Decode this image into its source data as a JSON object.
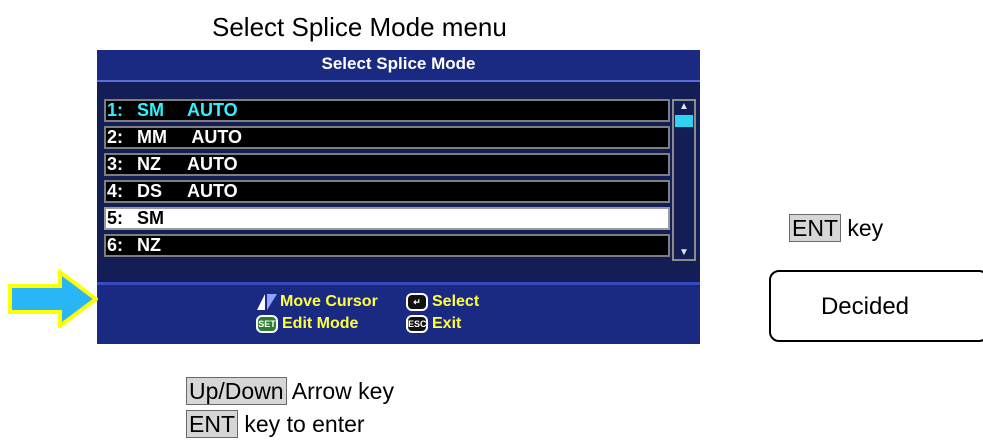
{
  "caption_top": "Select Splice Mode menu",
  "screen": {
    "title": "Select Splice Mode",
    "modes": [
      {
        "num": "1:",
        "fiber": "SM",
        "mode": "AUTO",
        "state": "highlight"
      },
      {
        "num": "2:",
        "fiber": "MM",
        "mode": " AUTO",
        "state": "normal"
      },
      {
        "num": "3:",
        "fiber": "NZ",
        "mode": "AUTO",
        "state": "normal"
      },
      {
        "num": "4:",
        "fiber": "DS",
        "mode": "AUTO",
        "state": "normal"
      },
      {
        "num": "5:",
        "fiber": "SM",
        "mode": "",
        "state": "selected"
      },
      {
        "num": "6:",
        "fiber": "NZ",
        "mode": "",
        "state": "normal"
      }
    ],
    "scrollbar": {
      "position_fraction": 0.0
    },
    "footer": {
      "move_cursor": "Move Cursor",
      "select": "Select",
      "edit_mode": "Edit Mode",
      "exit": "Exit",
      "set_badge": "SET",
      "esc_badge": "ESC"
    }
  },
  "annotations": {
    "ent_key_right": {
      "key": "ENT",
      "text": " key"
    },
    "decided": "Decided",
    "up_down": {
      "key": "Up/Down",
      "text": " Arrow key"
    },
    "ent_enter": {
      "key": "ENT",
      "text": " key to enter"
    }
  },
  "colors": {
    "screen_bg": "#141e56",
    "title_bar": "#1a2a82",
    "highlight_text": "#2ef2ff",
    "footer_text": "#ffff44",
    "pointer_arrow": "#29b6f6",
    "pointer_outline": "#ffff00"
  }
}
